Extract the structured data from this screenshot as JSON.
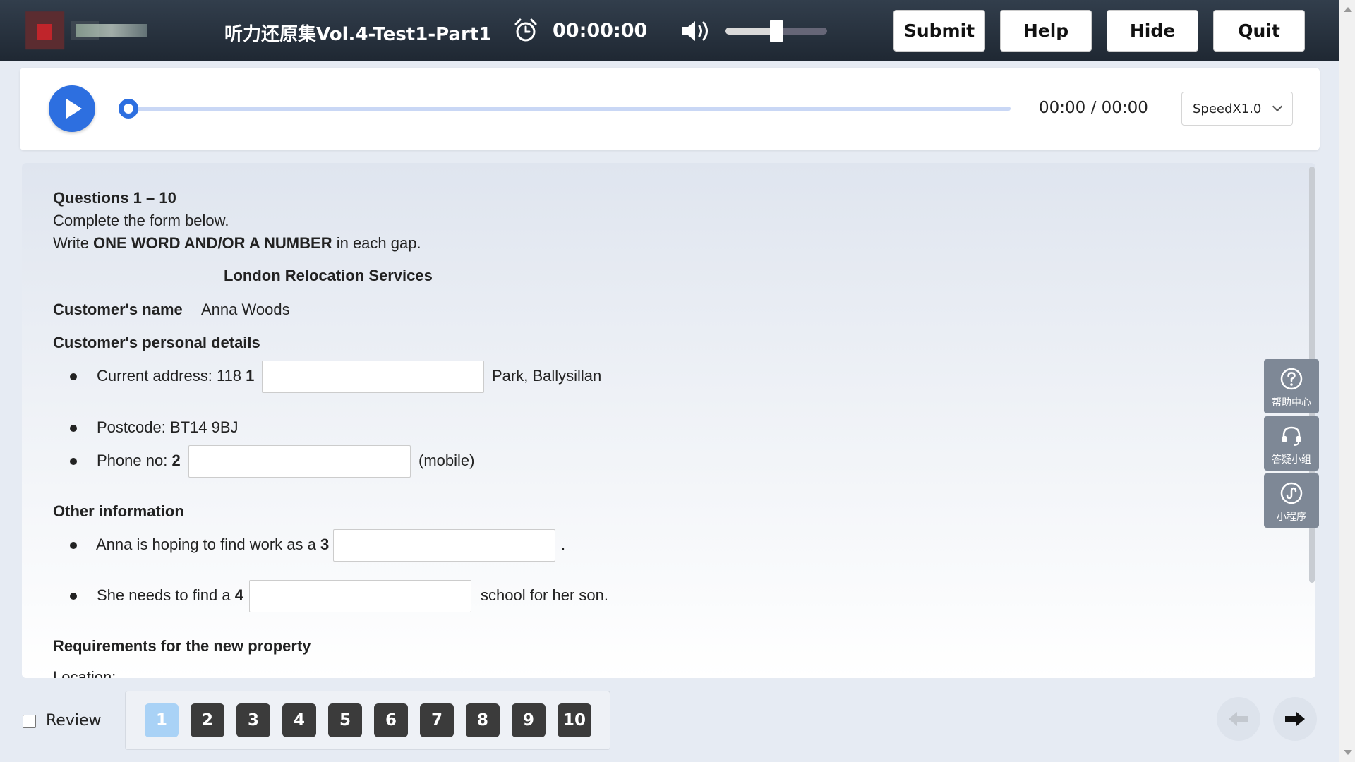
{
  "header": {
    "title": "听力还原集Vol.4-Test1-Part1",
    "timer": "00:00:00",
    "volume_level": 0.5,
    "buttons": {
      "submit": "Submit",
      "help": "Help",
      "hide": "Hide",
      "quit": "Quit"
    }
  },
  "player": {
    "time": "00:00 / 00:00",
    "progress": 0,
    "speed": "SpeedX1.0"
  },
  "content": {
    "questions_range": "Questions 1 – 10",
    "instruction1": "Complete the form below.",
    "instruction2_pre": "Write ",
    "instruction2_bold": "ONE WORD AND/OR A NUMBER",
    "instruction2_post": " in each gap.",
    "form_title": "London Relocation Services",
    "customer_name_label": "Customer's name",
    "customer_name_value": "Anna Woods",
    "personal_details_heading": "Customer's personal details",
    "item1_pre": "Current address: 118 ",
    "item1_num": "1",
    "item1_post": "Park, Ballysillan",
    "item_postcode": "Postcode: BT14 9BJ",
    "item2_pre": "Phone no: ",
    "item2_num": "2",
    "item2_post": "(mobile)",
    "other_info_heading": "Other information",
    "item3_pre": "Anna is hoping to find work as a ",
    "item3_num": "3",
    "item3_post": ".",
    "item4_pre": "She needs to find a ",
    "item4_num": "4",
    "item4_post": "school for her son.",
    "requirements_heading": "Requirements for the new property",
    "location_label": "Location:",
    "gap_values": [
      "",
      "",
      "",
      ""
    ]
  },
  "side_widgets": {
    "help_center": "帮助中心",
    "qa_group": "答疑小组",
    "mini_program": "小程序"
  },
  "bottom_nav": {
    "review_label": "Review",
    "review_checked": false,
    "question_numbers": [
      "1",
      "2",
      "3",
      "4",
      "5",
      "6",
      "7",
      "8",
      "9",
      "10"
    ],
    "active_question": "1"
  },
  "colors": {
    "accent": "#2d6fe0",
    "topbar": "#2a3440",
    "active_question": "#a9d2f6"
  }
}
